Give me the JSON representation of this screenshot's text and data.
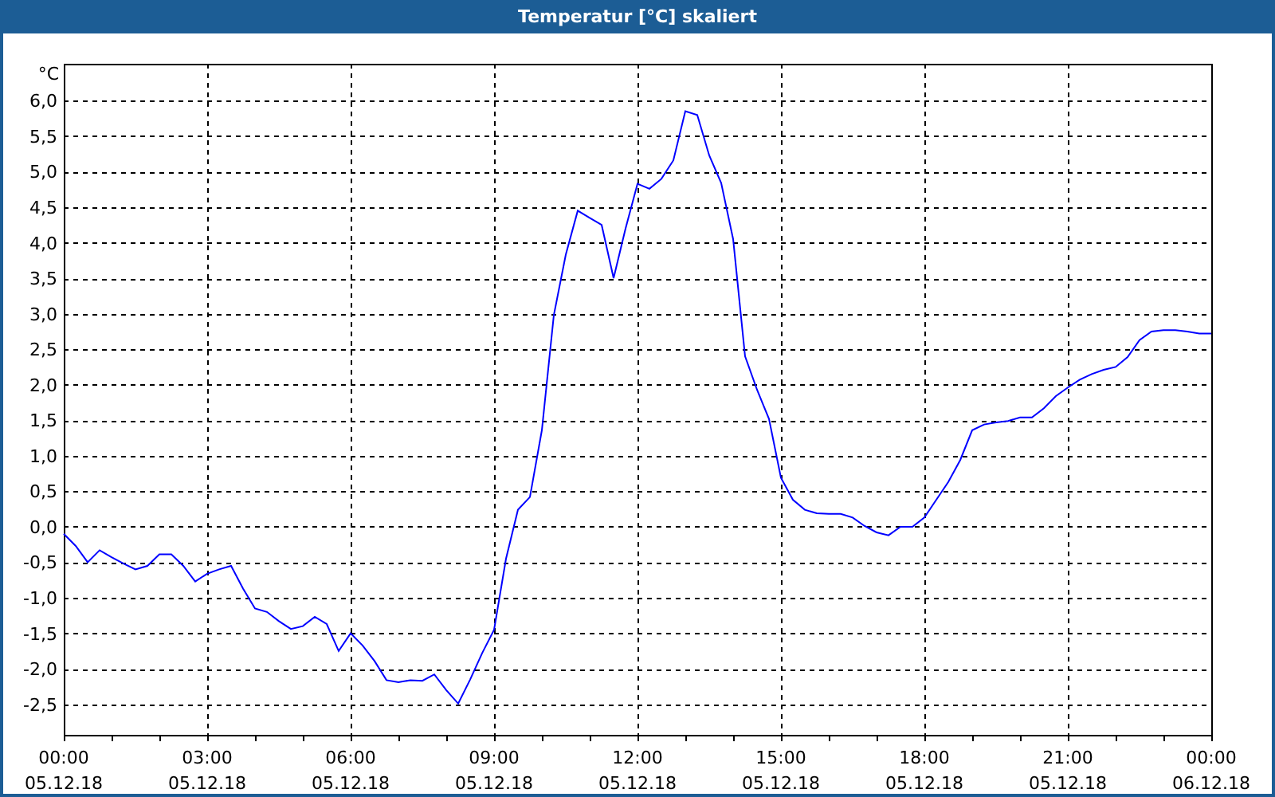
{
  "window": {
    "title": "Temperatur [°C] skaliert"
  },
  "chart": {
    "chart_data": {
      "type": "line",
      "grid": true,
      "ylabel": "°C",
      "ylim": [
        -2.93,
        6.52
      ],
      "categories": [
        "00:00\n05.12.18",
        null,
        null,
        null,
        null,
        null,
        null,
        null,
        null,
        null,
        null,
        null,
        "03:00\n05.12.18",
        null,
        null,
        null,
        null,
        null,
        null,
        null,
        null,
        null,
        null,
        null,
        "06:00\n05.12.18",
        null,
        null,
        null,
        null,
        null,
        null,
        null,
        null,
        null,
        null,
        null,
        "09:00\n05.12.18",
        null,
        null,
        null,
        null,
        null,
        null,
        null,
        null,
        null,
        null,
        null,
        "12:00\n05.12.18",
        null,
        null,
        null,
        null,
        null,
        null,
        null,
        null,
        null,
        null,
        null,
        "15:00\n05.12.18",
        null,
        null,
        null,
        null,
        null,
        null,
        null,
        null,
        null,
        null,
        null,
        "18:00\n05.12.18",
        null,
        null,
        null,
        null,
        null,
        null,
        null,
        null,
        null,
        null,
        null,
        "21:00\n05.12.18",
        null,
        null,
        null,
        null,
        null,
        null,
        null,
        null,
        null,
        null,
        null,
        "00:00\n06.12.18"
      ],
      "yticks": [
        {
          "value": 6,
          "label": "6,0"
        },
        {
          "value": 5.5,
          "label": "5,5"
        },
        {
          "value": 5,
          "label": "5,0"
        },
        {
          "value": 4.5,
          "label": "4,5"
        },
        {
          "value": 4,
          "label": "4,0"
        },
        {
          "value": 3.5,
          "label": "3,5"
        },
        {
          "value": 3,
          "label": "3,0"
        },
        {
          "value": 2.5,
          "label": "2,5"
        },
        {
          "value": 2,
          "label": "2,0"
        },
        {
          "value": 1.5,
          "label": "1,5"
        },
        {
          "value": 1,
          "label": "1,0"
        },
        {
          "value": 0.5,
          "label": "0,5"
        },
        {
          "value": 0,
          "label": "0,0"
        },
        {
          "value": -0.5,
          "label": "-0,5"
        },
        {
          "value": -1,
          "label": "-1,0"
        },
        {
          "value": -1.5,
          "label": "-1,5"
        },
        {
          "value": -2,
          "label": "-2,0"
        },
        {
          "value": -2.5,
          "label": "-2,5"
        }
      ],
      "series": [
        {
          "color": "#0000ff",
          "values": [
            -0.1,
            -0.27,
            -0.5,
            -0.33,
            -0.43,
            -0.52,
            -0.6,
            -0.55,
            -0.39,
            -0.39,
            -0.55,
            -0.77,
            -0.66,
            -0.6,
            -0.55,
            -0.87,
            -1.15,
            -1.2,
            -1.33,
            -1.44,
            -1.4,
            -1.27,
            -1.37,
            -1.75,
            -1.5,
            -1.67,
            -1.89,
            -2.16,
            -2.19,
            -2.16,
            -2.17,
            -2.08,
            -2.3,
            -2.49,
            -2.15,
            -1.78,
            -1.45,
            -0.45,
            0.24,
            0.42,
            1.36,
            2.98,
            3.83,
            4.45,
            4.35,
            4.25,
            3.5,
            4.2,
            4.83,
            4.76,
            4.9,
            5.16,
            5.85,
            5.8,
            5.23,
            4.84,
            4.05,
            2.4,
            1.93,
            1.52,
            0.69,
            0.38,
            0.24,
            0.19,
            0.18,
            0.18,
            0.13,
            0.01,
            -0.08,
            -0.12,
            0.0,
            0.0,
            0.13,
            0.38,
            0.63,
            0.94,
            1.36,
            1.44,
            1.47,
            1.49,
            1.54,
            1.54,
            1.67,
            1.84,
            1.96,
            2.07,
            2.15,
            2.21,
            2.25,
            2.39,
            2.63,
            2.75,
            2.77,
            2.77,
            2.75,
            2.72,
            2.72
          ]
        }
      ]
    }
  }
}
